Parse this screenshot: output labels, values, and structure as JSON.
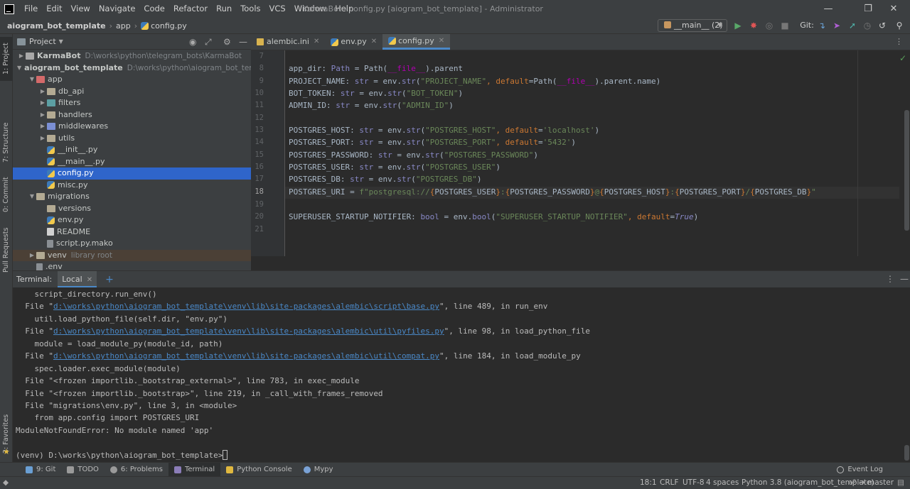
{
  "menu": [
    "File",
    "Edit",
    "View",
    "Navigate",
    "Code",
    "Refactor",
    "Run",
    "Tools",
    "VCS",
    "Window",
    "Help"
  ],
  "window_title": "KarmaBot - config.py [aiogram_bot_template] - Administrator",
  "breadcrumb": [
    "aiogram_bot_template",
    "app",
    "config.py"
  ],
  "run_config": "__main__ (2)",
  "git_label": "Git:",
  "left_tabs": [
    "1: Project",
    "7: Structure",
    "0: Commit",
    "Pull Requests",
    "2: Favorites"
  ],
  "project": {
    "title": "Project",
    "tree": [
      {
        "label": "KarmaBot",
        "path": "D:\\works\\python\\telegram_bots\\KarmaBot",
        "depth": 0,
        "arrow": "▶",
        "icon": "pkg",
        "bold": true
      },
      {
        "label": "aiogram_bot_template",
        "path": "D:\\works\\python\\aiogram_bot_template",
        "depth": 0,
        "arrow": "▼",
        "icon": "pkg",
        "bold": true
      },
      {
        "label": "app",
        "path": "",
        "depth": 1,
        "arrow": "▼",
        "icon": "app"
      },
      {
        "label": "db_api",
        "path": "",
        "depth": 2,
        "arrow": "▶",
        "icon": "folder"
      },
      {
        "label": "filters",
        "path": "",
        "depth": 2,
        "arrow": "▶",
        "icon": "teal"
      },
      {
        "label": "handlers",
        "path": "",
        "depth": 2,
        "arrow": "▶",
        "icon": "folder"
      },
      {
        "label": "middlewares",
        "path": "",
        "depth": 2,
        "arrow": "▶",
        "icon": "blue"
      },
      {
        "label": "utils",
        "path": "",
        "depth": 2,
        "arrow": "▶",
        "icon": "folder"
      },
      {
        "label": "__init__.py",
        "path": "",
        "depth": 2,
        "arrow": "",
        "icon": "py"
      },
      {
        "label": "__main__.py",
        "path": "",
        "depth": 2,
        "arrow": "",
        "icon": "py"
      },
      {
        "label": "config.py",
        "path": "",
        "depth": 2,
        "arrow": "",
        "icon": "py",
        "selected": true
      },
      {
        "label": "misc.py",
        "path": "",
        "depth": 2,
        "arrow": "",
        "icon": "py"
      },
      {
        "label": "migrations",
        "path": "",
        "depth": 1,
        "arrow": "▼",
        "icon": "folder"
      },
      {
        "label": "versions",
        "path": "",
        "depth": 2,
        "arrow": "",
        "icon": "folder"
      },
      {
        "label": "env.py",
        "path": "",
        "depth": 2,
        "arrow": "",
        "icon": "py"
      },
      {
        "label": "README",
        "path": "",
        "depth": 2,
        "arrow": "",
        "icon": "readme"
      },
      {
        "label": "script.py.mako",
        "path": "",
        "depth": 2,
        "arrow": "",
        "icon": "file"
      },
      {
        "label": "venv",
        "path": "library root",
        "depth": 1,
        "arrow": "▶",
        "icon": "folder",
        "excluded": true
      },
      {
        "label": ".env",
        "path": "",
        "depth": 1,
        "arrow": "",
        "icon": "file"
      }
    ]
  },
  "editor": {
    "tabs": [
      {
        "label": "alembic.ini",
        "icon": "ini",
        "active": false
      },
      {
        "label": "env.py",
        "icon": "py",
        "active": false
      },
      {
        "label": "config.py",
        "icon": "py",
        "active": true
      }
    ],
    "line_numbers": [
      "7",
      "8",
      "9",
      "10",
      "11",
      "12",
      "13",
      "14",
      "15",
      "16",
      "17",
      "18",
      "19",
      "20",
      "21"
    ],
    "current_line": "18",
    "lines": {
      "l8_a": "app_dir",
      "l8_b": ": ",
      "l8_c": "Path",
      "l8_d": " = Path(",
      "l8_e": "__file__",
      "l8_f": ").parent",
      "l9_a": "PROJECT_NAME: ",
      "l9_b": "str",
      "l9_c": " = env.",
      "l9_d": "str",
      "l9_e": "(",
      "l9_f": "\"PROJECT_NAME\"",
      "l9_g": ", ",
      "l9_h": "default",
      "l9_i": "=Path(",
      "l9_j": "__file__",
      "l9_k": ").parent.name)",
      "l10_a": "BOT_TOKEN: ",
      "l10_b": "str",
      "l10_c": " = env.",
      "l10_d": "str",
      "l10_e": "(",
      "l10_f": "\"BOT_TOKEN\"",
      "l10_g": ")",
      "l11_a": "ADMIN_ID: ",
      "l11_b": "str",
      "l11_c": " = env.",
      "l11_d": "str",
      "l11_e": "(",
      "l11_f": "\"ADMIN_ID\"",
      "l11_g": ")",
      "l13_a": "POSTGRES_HOST: ",
      "l13_b": "str",
      "l13_c": " = env.",
      "l13_d": "str",
      "l13_e": "(",
      "l13_f": "\"POSTGRES_HOST\"",
      "l13_g": ", ",
      "l13_h": "default",
      "l13_i": "=",
      "l13_j": "'localhost'",
      "l13_k": ")",
      "l14_a": "POSTGRES_PORT: ",
      "l14_b": "str",
      "l14_c": " = env.",
      "l14_d": "str",
      "l14_e": "(",
      "l14_f": "\"POSTGRES_PORT\"",
      "l14_g": ", ",
      "l14_h": "default",
      "l14_i": "=",
      "l14_j": "'5432'",
      "l14_k": ")",
      "l15_a": "POSTGRES_PASSWORD: ",
      "l15_b": "str",
      "l15_c": " = env.",
      "l15_d": "str",
      "l15_e": "(",
      "l15_f": "\"POSTGRES_PASSWORD\"",
      "l15_g": ")",
      "l16_a": "POSTGRES_USER: ",
      "l16_b": "str",
      "l16_c": " = env.",
      "l16_d": "str",
      "l16_e": "(",
      "l16_f": "\"POSTGRES_USER\"",
      "l16_g": ")",
      "l17_a": "POSTGRES_DB: ",
      "l17_b": "str",
      "l17_c": " = env.",
      "l17_d": "str",
      "l17_e": "(",
      "l17_f": "\"POSTGRES_DB\"",
      "l17_g": ")",
      "l18_a": "POSTGRES_URI",
      "l18_b": " = ",
      "l18_c": "f\"postgresql://",
      "l18_d": "{",
      "l18_e": "POSTGRES_USER",
      "l18_f": "}",
      "l18_g": ":",
      "l18_h": "{",
      "l18_i": "POSTGRES_PASSWORD",
      "l18_j": "}",
      "l18_k": "@",
      "l18_l": "{",
      "l18_m": "POSTGRES_HOST",
      "l18_n": "}",
      "l18_o": ":",
      "l18_p": "{",
      "l18_q": "POSTGRES_PORT",
      "l18_r": "}",
      "l18_s": "/",
      "l18_t": "{",
      "l18_u": "POSTGRES_DB",
      "l18_v": "}",
      "l18_w": "\"",
      "l20_a": "SUPERUSER_STARTUP_NOTIFIER: ",
      "l20_b": "bool",
      "l20_c": " = env.",
      "l20_d": "bool",
      "l20_e": "(",
      "l20_f": "\"SUPERUSER_STARTUP_NOTIFIER\"",
      "l20_g": ", ",
      "l20_h": "default",
      "l20_i": "=",
      "l20_j": "True",
      "l20_k": ")"
    }
  },
  "terminal": {
    "label": "Terminal:",
    "tab": "Local",
    "lines": {
      "t1": "    script_directory.run_env()",
      "t2_a": "  File \"",
      "t2_b": "d:\\works\\python\\aiogram_bot_template\\venv\\lib\\site-packages\\alembic\\script\\base.py",
      "t2_c": "\", line 489, in run_env",
      "t3": "    util.load_python_file(self.dir, \"env.py\")",
      "t4_a": "  File \"",
      "t4_b": "d:\\works\\python\\aiogram_bot_template\\venv\\lib\\site-packages\\alembic\\util\\pyfiles.py",
      "t4_c": "\", line 98, in load_python_file",
      "t5": "    module = load_module_py(module_id, path)",
      "t6_a": "  File \"",
      "t6_b": "d:\\works\\python\\aiogram_bot_template\\venv\\lib\\site-packages\\alembic\\util\\compat.py",
      "t6_c": "\", line 184, in load_module_py",
      "t7": "    spec.loader.exec_module(module)",
      "t8": "  File \"<frozen importlib._bootstrap_external>\", line 783, in exec_module",
      "t9": "  File \"<frozen importlib._bootstrap>\", line 219, in _call_with_frames_removed",
      "t10": "  File \"migrations\\env.py\", line 3, in <module>",
      "t11": "    from app.config import POSTGRES_URI",
      "t12": "ModuleNotFoundError: No module named 'app'",
      "prompt": "(venv) D:\\works\\python\\aiogram_bot_template>"
    }
  },
  "bottom_tools": [
    {
      "label": "9: Git",
      "color": "#6a9fd4",
      "active": false
    },
    {
      "label": "TODO",
      "color": "#9a9a9a",
      "active": false
    },
    {
      "label": "6: Problems",
      "color": "#9a9a9a",
      "active": false
    },
    {
      "label": "Terminal",
      "color": "#8b7db8",
      "active": true
    },
    {
      "label": "Python Console",
      "color": "#e0b83f",
      "active": false
    },
    {
      "label": "Mypy",
      "color": "#7aa2d6",
      "active": false
    }
  ],
  "event_log": "Event Log",
  "status": {
    "position": "18:1",
    "line_sep": "CRLF",
    "encoding": "UTF-8",
    "indent": "4 spaces",
    "interpreter": "Python 3.8 (aiogram_bot_template)",
    "branch": "master"
  }
}
